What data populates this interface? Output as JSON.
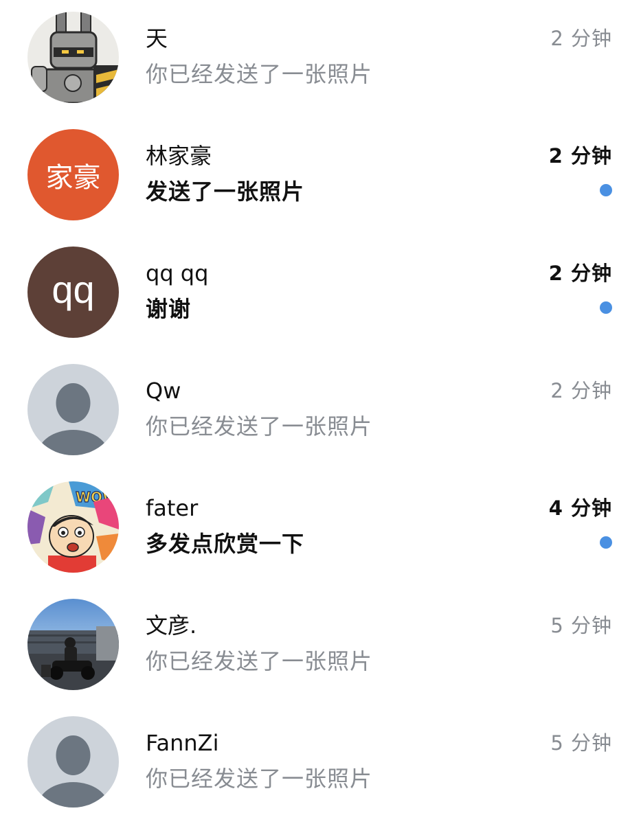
{
  "conversations": [
    {
      "avatar_type": "image",
      "avatar_icon": "robot-knight-avatar",
      "name": "天",
      "preview": "你已经发送了一张照片",
      "time": "2 分钟",
      "unread": false
    },
    {
      "avatar_type": "text",
      "avatar_text": "家豪",
      "avatar_color": "#e0582f",
      "name": "林家豪",
      "preview": "发送了一张照片",
      "time": "2 分钟",
      "unread": true
    },
    {
      "avatar_type": "text",
      "avatar_text": "qq",
      "avatar_color": "#5d4037",
      "name": "qq qq",
      "preview": "谢谢",
      "time": "2 分钟",
      "unread": true
    },
    {
      "avatar_type": "default",
      "avatar_icon": "default-user-avatar",
      "name": "Qw",
      "preview": "你已经发送了一张照片",
      "time": "2 分钟",
      "unread": false
    },
    {
      "avatar_type": "image",
      "avatar_icon": "cartoon-character-avatar",
      "name": "fater",
      "preview": "多发点欣赏一下",
      "time": "4 分钟",
      "unread": true
    },
    {
      "avatar_type": "image",
      "avatar_icon": "person-motorcycle-photo-avatar",
      "name": "文彦.",
      "preview": "你已经发送了一张照片",
      "time": "5 分钟",
      "unread": false
    },
    {
      "avatar_type": "default",
      "avatar_icon": "default-user-avatar",
      "name": "FannZi",
      "preview": "你已经发送了一张照片",
      "time": "5 分钟",
      "unread": false
    }
  ],
  "colors": {
    "unread_dot": "#4a90e2",
    "muted_text": "#888c92",
    "primary_text": "#111111",
    "default_avatar_bg": "#cdd3da",
    "default_avatar_fg": "#6c7681"
  }
}
